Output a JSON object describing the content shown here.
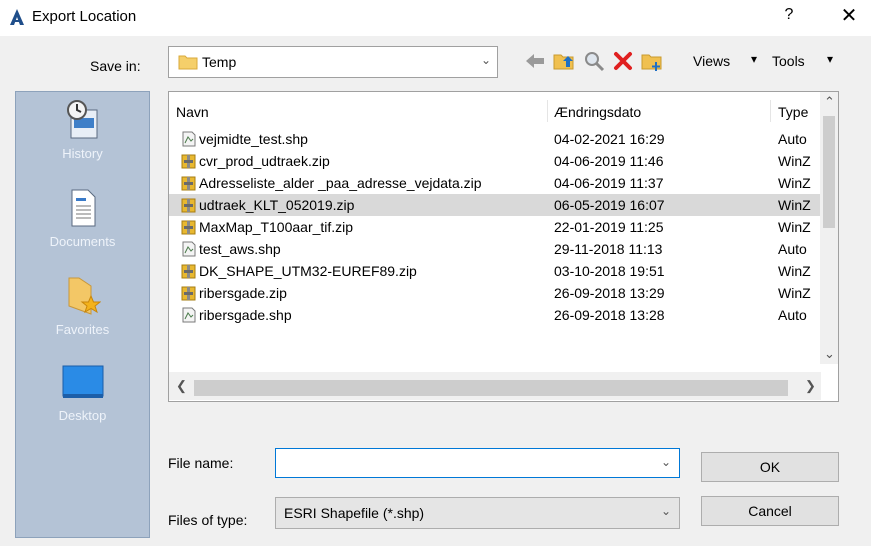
{
  "window": {
    "title": "Export Location",
    "help": "?",
    "close": "✕"
  },
  "location": {
    "label": "Save in:",
    "value": "Temp"
  },
  "toolbar": {
    "views_label": "Views",
    "tools_label": "Tools"
  },
  "places": [
    {
      "label": "History",
      "icon": "history-icon"
    },
    {
      "label": "Documents",
      "icon": "documents-icon"
    },
    {
      "label": "Favorites",
      "icon": "favorites-folder-icon"
    },
    {
      "label": "Desktop",
      "icon": "desktop-icon"
    }
  ],
  "file_list": {
    "columns": [
      "Navn",
      "Ændringsdato",
      "Type"
    ],
    "rows": [
      {
        "name": "vejmidte_test.shp",
        "date": "04-02-2021 16:29",
        "type": "Auto",
        "icon": "shapefile-icon",
        "selected": false
      },
      {
        "name": "cvr_prod_udtraek.zip",
        "date": "04-06-2019 11:46",
        "type": "WinZ",
        "icon": "zip-archive-icon",
        "selected": false
      },
      {
        "name": "Adresseliste_alder _paa_adresse_vejdata.zip",
        "date": "04-06-2019 11:37",
        "type": "WinZ",
        "icon": "zip-archive-icon",
        "selected": false
      },
      {
        "name": "udtraek_KLT_052019.zip",
        "date": "06-05-2019 16:07",
        "type": "WinZ",
        "icon": "zip-archive-icon",
        "selected": true
      },
      {
        "name": "MaxMap_T100aar_tif.zip",
        "date": "22-01-2019 11:25",
        "type": "WinZ",
        "icon": "zip-archive-icon",
        "selected": false
      },
      {
        "name": "test_aws.shp",
        "date": "29-11-2018 11:13",
        "type": "Auto",
        "icon": "shapefile-icon",
        "selected": false
      },
      {
        "name": "DK_SHAPE_UTM32-EUREF89.zip",
        "date": "03-10-2018 19:51",
        "type": "WinZ",
        "icon": "zip-archive-icon",
        "selected": false
      },
      {
        "name": "ribersgade.zip",
        "date": "26-09-2018 13:29",
        "type": "WinZ",
        "icon": "zip-archive-icon",
        "selected": false
      },
      {
        "name": "ribersgade.shp",
        "date": "26-09-2018 13:28",
        "type": "Auto",
        "icon": "shapefile-icon",
        "selected": false
      }
    ]
  },
  "file_name": {
    "label": "File name:",
    "value": ""
  },
  "file_type": {
    "label": "Files of type:",
    "value": "ESRI Shapefile  (*.shp)"
  },
  "buttons": {
    "ok": "OK",
    "cancel": "Cancel"
  }
}
